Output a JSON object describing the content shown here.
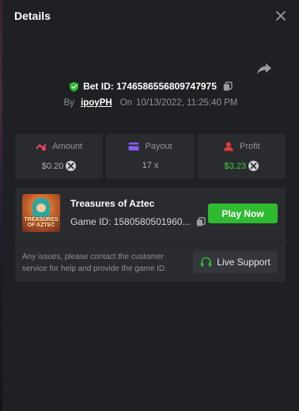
{
  "header": {
    "title": "Details"
  },
  "bet": {
    "id_text": "Bet ID: 1746586556809747975",
    "by_label": "By",
    "username": "ipoyPH",
    "on_label": "On",
    "datetime": "10/13/2022, 11:25:40 PM"
  },
  "stats": {
    "amount": {
      "label": "Amount",
      "value": "$0.20"
    },
    "payout": {
      "label": "Payout",
      "value": "17 x"
    },
    "profit": {
      "label": "Profit",
      "value": "$3.23"
    }
  },
  "game": {
    "name": "Treasures of Aztec",
    "id_text": "Game ID: 1580580501960...",
    "thumb_text": "TREASURES OF AZTEC",
    "play_label": "Play Now",
    "help_text": "Any issues, please contact the customer service for help and provide the game ID.",
    "support_label": "Live Support"
  },
  "icons": {
    "close": "close-icon",
    "share": "share-icon",
    "verified": "shield-check-icon",
    "copy": "copy-icon",
    "amount": "coins-icon",
    "payout": "card-icon",
    "profit": "profit-icon",
    "coin": "coin-icon",
    "support": "headset-icon"
  },
  "colors": {
    "panel_bg": "#1f2023",
    "card_bg": "#2a2b2f",
    "accent_green": "#2fbb2f",
    "profit_green": "#3ecf3e",
    "amount_icon": "#e8455c",
    "payout_icon": "#8b5cf6",
    "profit_icon": "#e23b3b"
  }
}
